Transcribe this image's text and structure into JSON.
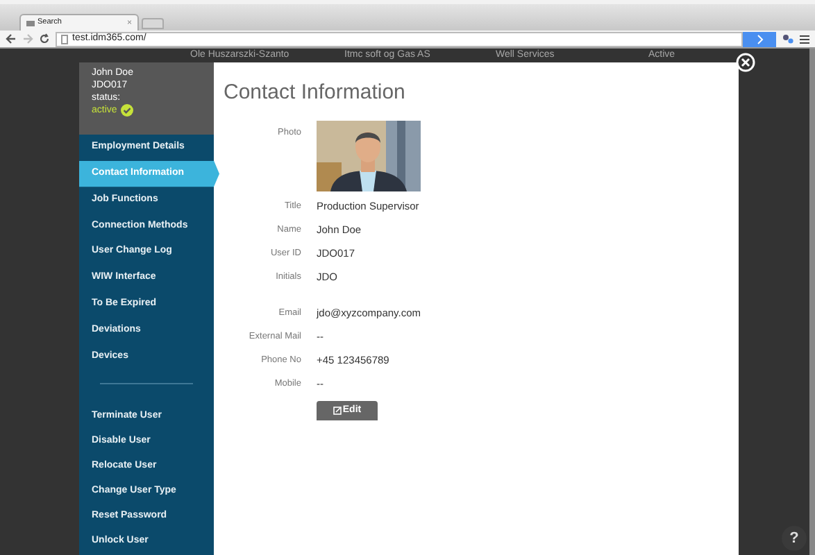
{
  "browser": {
    "tab_title": "Search",
    "tab_close": "×",
    "url": "test.idm365.com/"
  },
  "background_row": [
    "Ole Huszarszki-Szanto",
    "Itmc soft og Gas AS",
    "Well Services",
    "Active"
  ],
  "user": {
    "name": "John Doe",
    "id": "JDO017",
    "status_label": "status:",
    "status": "active",
    "active": true
  },
  "nav": [
    {
      "label": "Employment Details",
      "selected": false
    },
    {
      "label": "Contact Information",
      "selected": true
    },
    {
      "label": "Job Functions",
      "selected": false
    },
    {
      "label": "Connection Methods",
      "selected": false
    },
    {
      "label": "User Change Log",
      "selected": false
    },
    {
      "label": "WIW Interface",
      "selected": false
    },
    {
      "label": "To Be Expired",
      "selected": false
    },
    {
      "label": "Deviations",
      "selected": false
    },
    {
      "label": "Devices",
      "selected": false
    }
  ],
  "actions": [
    "Terminate User",
    "Disable User",
    "Relocate User",
    "Change User Type",
    "Reset Password",
    "Unlock User"
  ],
  "content": {
    "title": "Contact Information",
    "photo_label": "Photo",
    "fields": [
      {
        "label": "Title",
        "value": "Production Supervisor"
      },
      {
        "label": "Name",
        "value": "John Doe"
      },
      {
        "label": "User ID",
        "value": "JDO017"
      },
      {
        "label": "Initials",
        "value": "JDO"
      }
    ],
    "contact_fields": [
      {
        "label": "Email",
        "value": "jdo@xyzcompany.com"
      },
      {
        "label": "External Mail",
        "value": "--"
      },
      {
        "label": "Phone No",
        "value": "+45 123456789"
      },
      {
        "label": "Mobile",
        "value": "--"
      }
    ],
    "edit_button": "Edit"
  },
  "help": "?"
}
